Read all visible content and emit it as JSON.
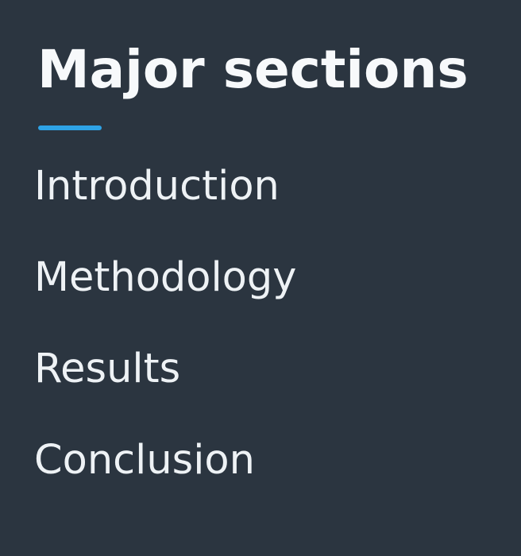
{
  "heading": {
    "title": "Major sections",
    "accent_color": "#2ea3e6"
  },
  "sections": [
    {
      "label": "Introduction"
    },
    {
      "label": "Methodology"
    },
    {
      "label": "Results"
    },
    {
      "label": "Conclusion"
    }
  ],
  "colors": {
    "background": "#2b3540",
    "text": "#f3f5f7"
  }
}
